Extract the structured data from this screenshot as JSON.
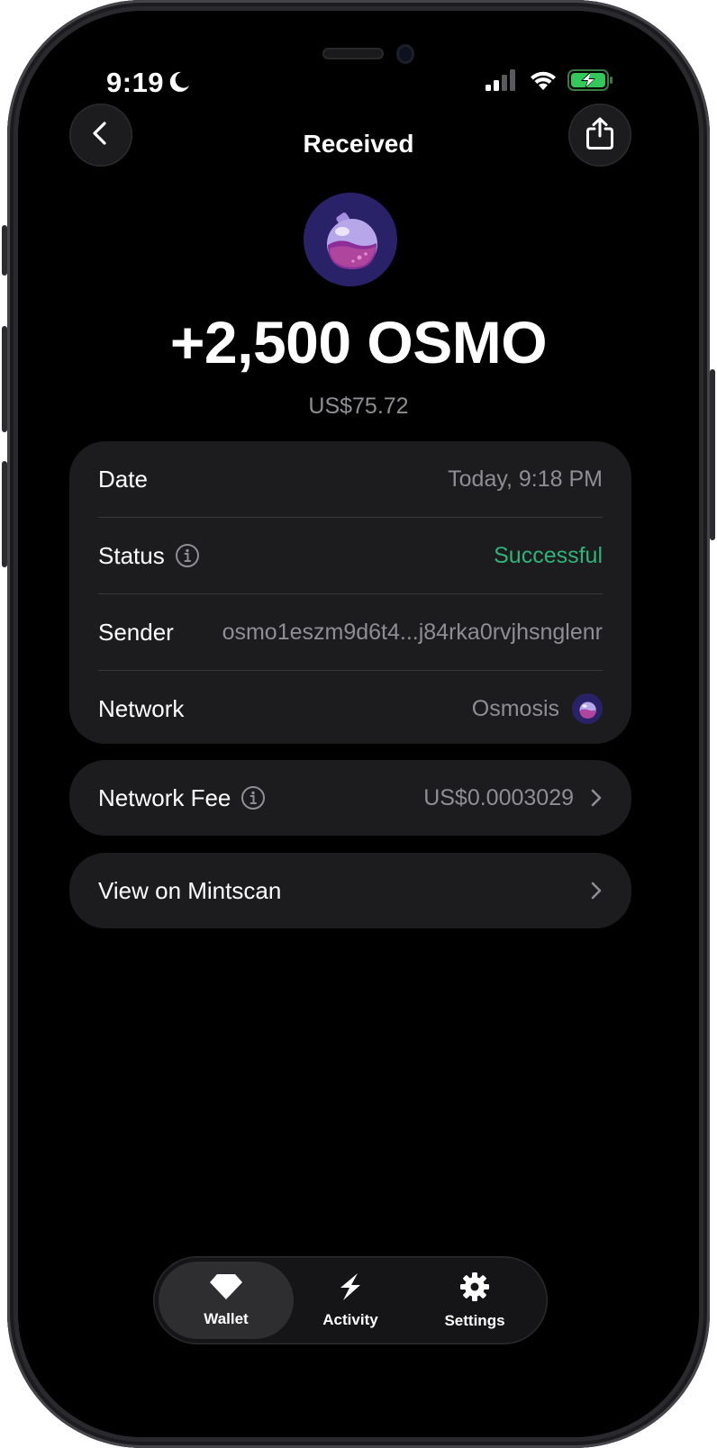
{
  "status_bar": {
    "time": "9:19",
    "icons": [
      "moon-icon",
      "signal-icon",
      "wifi-icon",
      "battery-charging-icon"
    ]
  },
  "header": {
    "title": "Received",
    "back_icon": "chevron-left-icon",
    "share_icon": "share-icon"
  },
  "transaction": {
    "token_icon": "osmosis-token-icon",
    "amount": "+2,500 OSMO",
    "fiat_value": "US$75.72"
  },
  "details": {
    "date_label": "Date",
    "date_value": "Today, 9:18 PM",
    "status_label": "Status",
    "status_value": "Successful",
    "sender_label": "Sender",
    "sender_value": "osmo1eszm9d6t4...j84rka0rvjhsnglenr",
    "network_label": "Network",
    "network_value": "Osmosis"
  },
  "fee": {
    "label": "Network Fee",
    "value": "US$0.0003029"
  },
  "explorer": {
    "label": "View on Mintscan"
  },
  "tabbar": {
    "tabs": [
      {
        "label": "Wallet",
        "icon": "diamond-icon",
        "active": true
      },
      {
        "label": "Activity",
        "icon": "lightning-icon",
        "active": false
      },
      {
        "label": "Settings",
        "icon": "gear-icon",
        "active": false
      }
    ]
  },
  "colors": {
    "background": "#000000",
    "card": "#1c1c1e",
    "secondary_text": "#8e8e93",
    "success": "#2fb37a",
    "battery_green": "#34c759",
    "token_bg": "#2a2268"
  }
}
